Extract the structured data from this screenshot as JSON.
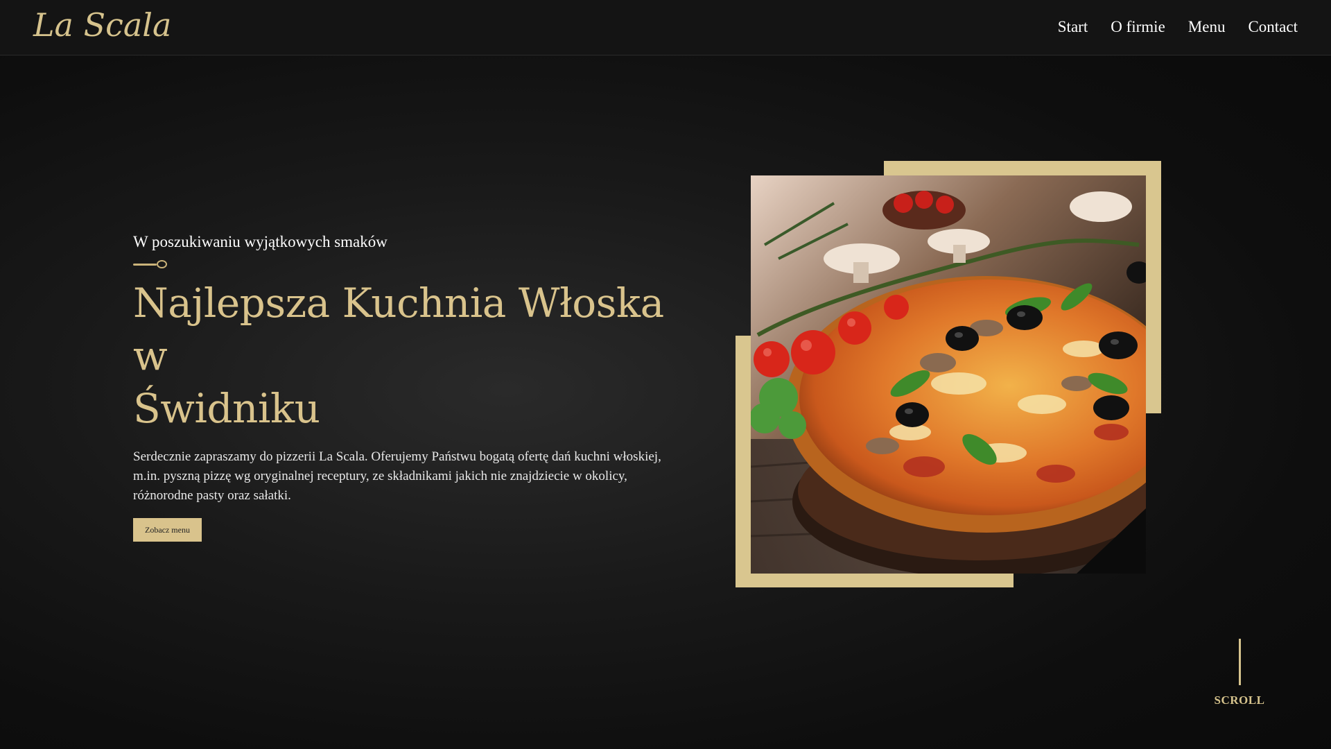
{
  "header": {
    "logo": "La Scala",
    "nav": [
      {
        "label": "Start"
      },
      {
        "label": "O firmie"
      },
      {
        "label": "Menu"
      },
      {
        "label": "Contact"
      }
    ]
  },
  "hero": {
    "subtitle": "W poszukiwaniu wyjątkowych smaków",
    "title_line1": "Najlepsza Kuchnia Włoska w",
    "title_line2": "Świdniku",
    "description": "Serdecznie zapraszamy do pizzerii La Scala. Oferujemy Państwu bogatą ofertę dań kuchni włoskiej, m.in. pyszną pizzę wg oryginalnej receptury, ze składnikami jakich nie znajdziecie w okolicy, różnorodne pasty oraz sałatki.",
    "button_label": "Zobacz menu",
    "image_alt": "pizza-photo"
  },
  "scroll": {
    "label": "SCROLL"
  },
  "colors": {
    "accent": "#d9c38c",
    "background": "#121212",
    "header_bg": "#141414"
  }
}
